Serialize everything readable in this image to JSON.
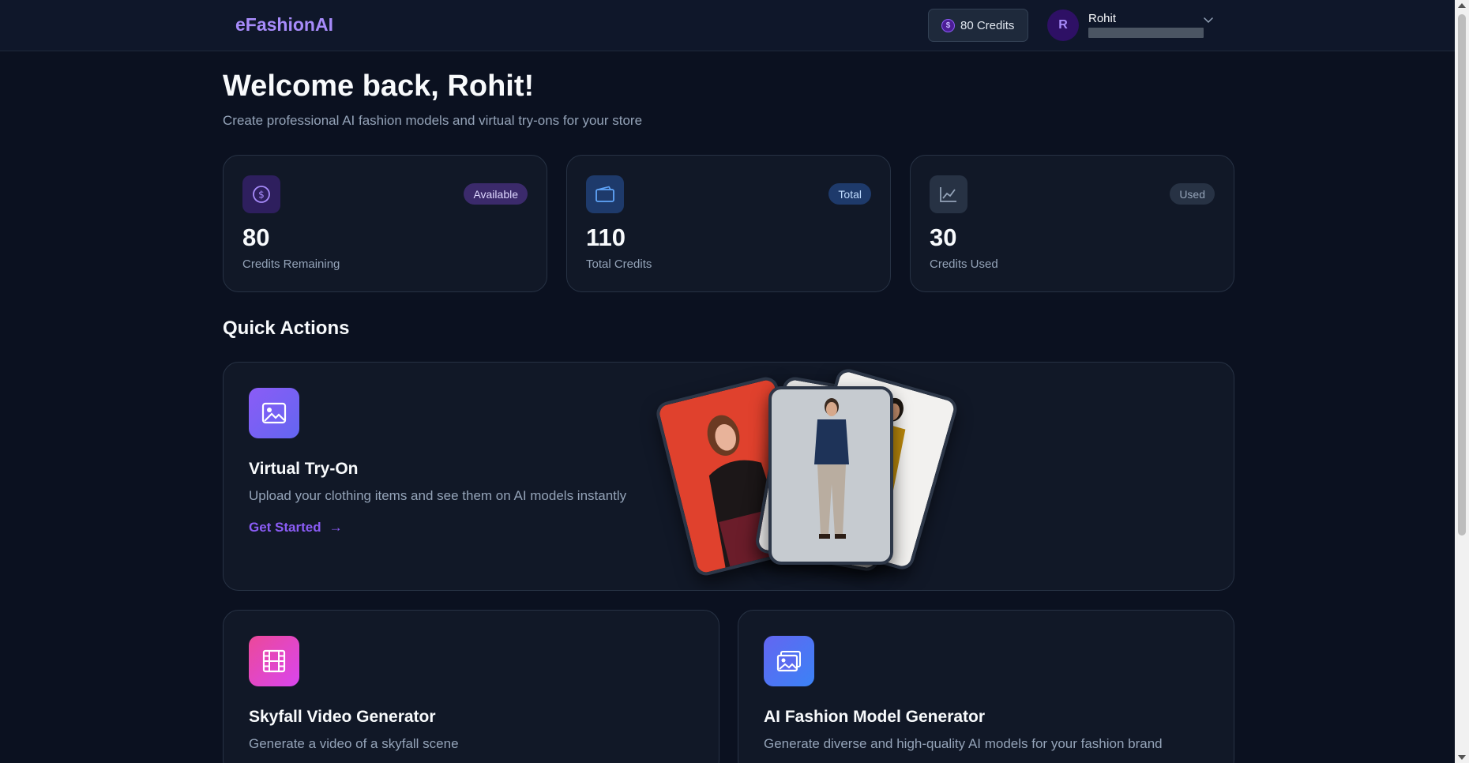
{
  "header": {
    "brand": "eFashionAI",
    "credits_label": "80 Credits",
    "user_initial": "R",
    "user_name": "Rohit",
    "user_email": ""
  },
  "welcome": {
    "title": "Welcome back, Rohit!",
    "subtitle": "Create professional AI fashion models and virtual try-ons for your store"
  },
  "stats": [
    {
      "badge": "Available",
      "value": "80",
      "label": "Credits Remaining",
      "icon": "dollar-coin-icon",
      "accent": "#8b5cf6"
    },
    {
      "badge": "Total",
      "value": "110",
      "label": "Total Credits",
      "icon": "wallet-icon",
      "accent": "#3b82f6"
    },
    {
      "badge": "Used",
      "value": "30",
      "label": "Credits Used",
      "icon": "line-chart-icon",
      "accent": "#94a3b8"
    }
  ],
  "quick_actions": {
    "title": "Quick Actions",
    "virtual_tryon": {
      "title": "Virtual Try-On",
      "description": "Upload your clothing items and see them on AI models instantly",
      "link": "Get Started",
      "arrow": "→"
    },
    "video_generator": {
      "title": "Skyfall Video Generator",
      "description": "Generate a video of a skyfall scene"
    },
    "model_generator": {
      "title": "AI Fashion Model Generator",
      "description": "Generate diverse and high-quality AI models for your fashion brand"
    }
  },
  "colors": {
    "background": "#0b1120",
    "card": "#111827",
    "brand": "#a78bfa",
    "accent_purple": "#8b5cf6",
    "accent_blue": "#3b82f6",
    "accent_pink": "#ec4899"
  }
}
